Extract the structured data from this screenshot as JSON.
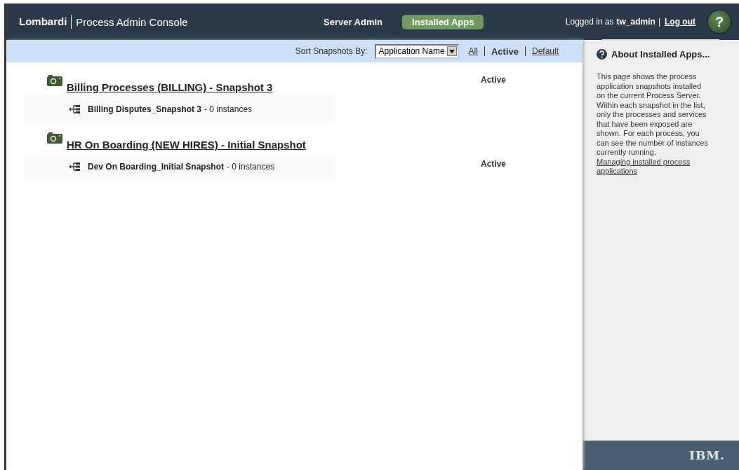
{
  "header": {
    "brand": "Lombardi",
    "product": "Process Admin Console",
    "nav": [
      {
        "label": "Server Admin",
        "selected": false
      },
      {
        "label": "Installed Apps",
        "selected": true
      }
    ],
    "login_prefix": "Logged in as",
    "user": "tw_admin",
    "separator": "|",
    "logout": "Log out",
    "help": "?"
  },
  "sort_bar": {
    "label": "Sort Snapshots By:",
    "dropdown": "Application Name",
    "filters": [
      {
        "label": "All",
        "selected": false
      },
      {
        "label": "Active",
        "selected": true
      },
      {
        "label": "Default",
        "selected": false
      }
    ]
  },
  "snapshots": [
    {
      "title": "Billing Processes (BILLING) - Snapshot 3",
      "status": "Active",
      "processes": [
        {
          "name": "Billing Disputes_Snapshot 3",
          "count": "- 0 instances"
        }
      ]
    },
    {
      "title": "HR On Boarding (NEW HIRES) - Initial Snapshot",
      "status": "Active",
      "processes": [
        {
          "name": "Dev On Boarding_Initial Snapshot",
          "count": "- 0 instances"
        }
      ]
    }
  ],
  "sidebar": {
    "title": "About Installed Apps...",
    "text": "This page shows the process application snapshots installed on the current Process Server. Within each snapshot in the list, only the processes and services that have been exposed are shown. For each process, you can see the number of instances currently running.",
    "link": "Managing installed process applications"
  },
  "footer": {
    "logo": "IBM."
  }
}
